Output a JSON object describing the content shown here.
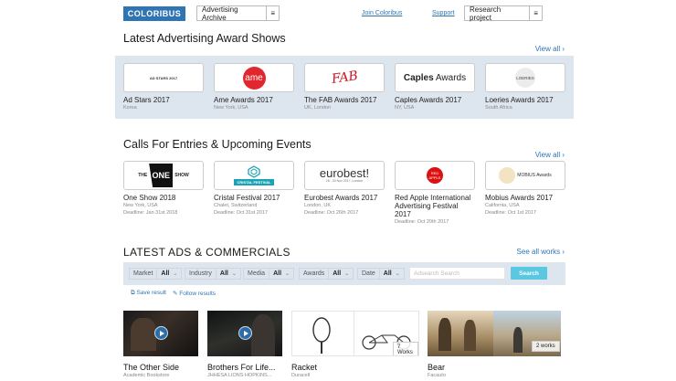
{
  "header": {
    "logo": "COLORIBUS",
    "archive_dropdown": "Advertising Archive",
    "menu_glyph": "≡",
    "join_link": "Join Coloribus",
    "support_link": "Support",
    "research_dropdown": "Research project"
  },
  "award_shows": {
    "title": "Latest Advertising Award Shows",
    "view_all": "View all",
    "items": [
      {
        "name": "Ad Stars 2017",
        "location": "Korea",
        "logo_text": "AD STARS 2017"
      },
      {
        "name": "Ame Awards 2017",
        "location": "New York, USA",
        "logo_text": "ame"
      },
      {
        "name": "The FAB Awards 2017",
        "location": "UK, London",
        "logo_text": "FAB"
      },
      {
        "name": "Caples Awards 2017",
        "location": "NY, USA",
        "logo_text_a": "Caples",
        "logo_text_b": "Awards"
      },
      {
        "name": "Loeries Awards 2017",
        "location": "South Africa",
        "logo_text": "LOERIES"
      }
    ]
  },
  "events": {
    "title": "Calls For Entries & Upcoming Events",
    "view_all": "View all",
    "items": [
      {
        "name": "One Show 2018",
        "location": "New York, USA",
        "deadline": "Deadline: Jan 31st 2018",
        "logo_text_a": "THE",
        "logo_text_b": "ONE",
        "logo_text_c": "SHOW"
      },
      {
        "name": "Cristal Festival 2017",
        "location": "Chalet, Switzerland",
        "deadline": "Deadline: Oct 31st 2017",
        "logo_text": "CRISTAL FESTIVAL"
      },
      {
        "name": "Eurobest Awards 2017",
        "location": "London, UK",
        "deadline": "Deadline: Oct 26th 2017",
        "logo_text": "eurobest",
        "logo_sub": "28 - 30 Nov 2017, London"
      },
      {
        "name": "Red Apple International Advertising Festival 2017",
        "location": "",
        "deadline": "Deadline: Oct 20th 2017",
        "logo_text": "RED APPLE"
      },
      {
        "name": "Mobius Awards 2017",
        "location": "California, USA",
        "deadline": "Deadline: Oct 1st 2017",
        "logo_text": "MOBIUS Awards"
      }
    ]
  },
  "latest_ads": {
    "title": "LATEST ADS & COMMERCIALS",
    "see_all": "See all works",
    "filters": [
      {
        "label": "Market",
        "value": "All"
      },
      {
        "label": "Industry",
        "value": "All"
      },
      {
        "label": "Media",
        "value": "All"
      },
      {
        "label": "Awards",
        "value": "All"
      },
      {
        "label": "Date",
        "value": "All"
      }
    ],
    "search_placeholder": "Adsearch Search",
    "search_button": "Search",
    "save_result": "Save result",
    "follow_results": "Follow results",
    "works": [
      {
        "title": "The Other Side",
        "brand": "Academic Bookstore"
      },
      {
        "title": "Brothers For Life...",
        "brand": "JHHESA LIONS HOPKINS..."
      },
      {
        "title": "Racket",
        "brand": "Duracell",
        "count": "7 Works"
      },
      {
        "title": "Bear",
        "brand": "Facauto",
        "count": "2 works"
      }
    ]
  },
  "colors": {
    "accent": "#2f74b3",
    "band": "#dde6ee",
    "search": "#5ac8e0"
  }
}
